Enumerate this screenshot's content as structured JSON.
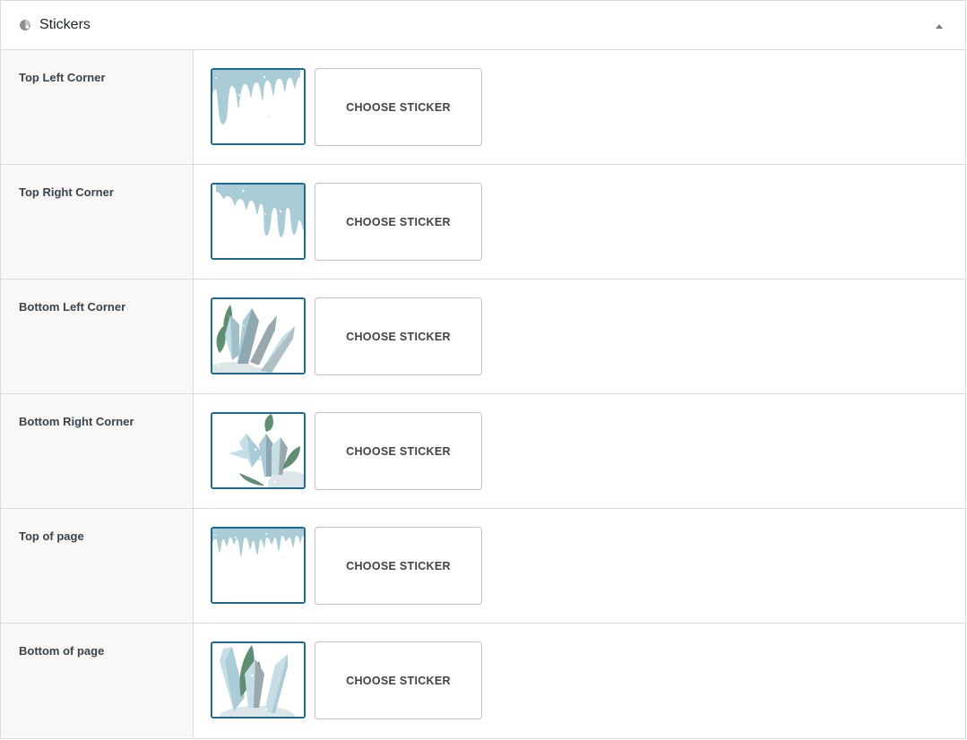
{
  "panel": {
    "title": "Stickers",
    "header_icon": "palette-icon",
    "toggle_icon": "caret-up-icon"
  },
  "colors": {
    "accent": "#1e6b92",
    "ice": "#a9ccd6",
    "crystal_light": "#c5dde4",
    "crystal_grey": "#9aa7ad",
    "leaf": "#5f8e72",
    "label_bg": "#f7f8f7",
    "border": "#dcdcde"
  },
  "rows": [
    {
      "label": "Top Left Corner",
      "sticker": "icicles-top-left",
      "button": "CHOOSE STICKER"
    },
    {
      "label": "Top Right Corner",
      "sticker": "icicles-top-right",
      "button": "CHOOSE STICKER"
    },
    {
      "label": "Bottom Left Corner",
      "sticker": "crystals-bottom-left",
      "button": "CHOOSE STICKER"
    },
    {
      "label": "Bottom Right Corner",
      "sticker": "crystals-bottom-right",
      "button": "CHOOSE STICKER"
    },
    {
      "label": "Top of page",
      "sticker": "icicles-top",
      "button": "CHOOSE STICKER"
    },
    {
      "label": "Bottom of page",
      "sticker": "crystals-bottom",
      "button": "CHOOSE STICKER"
    }
  ]
}
